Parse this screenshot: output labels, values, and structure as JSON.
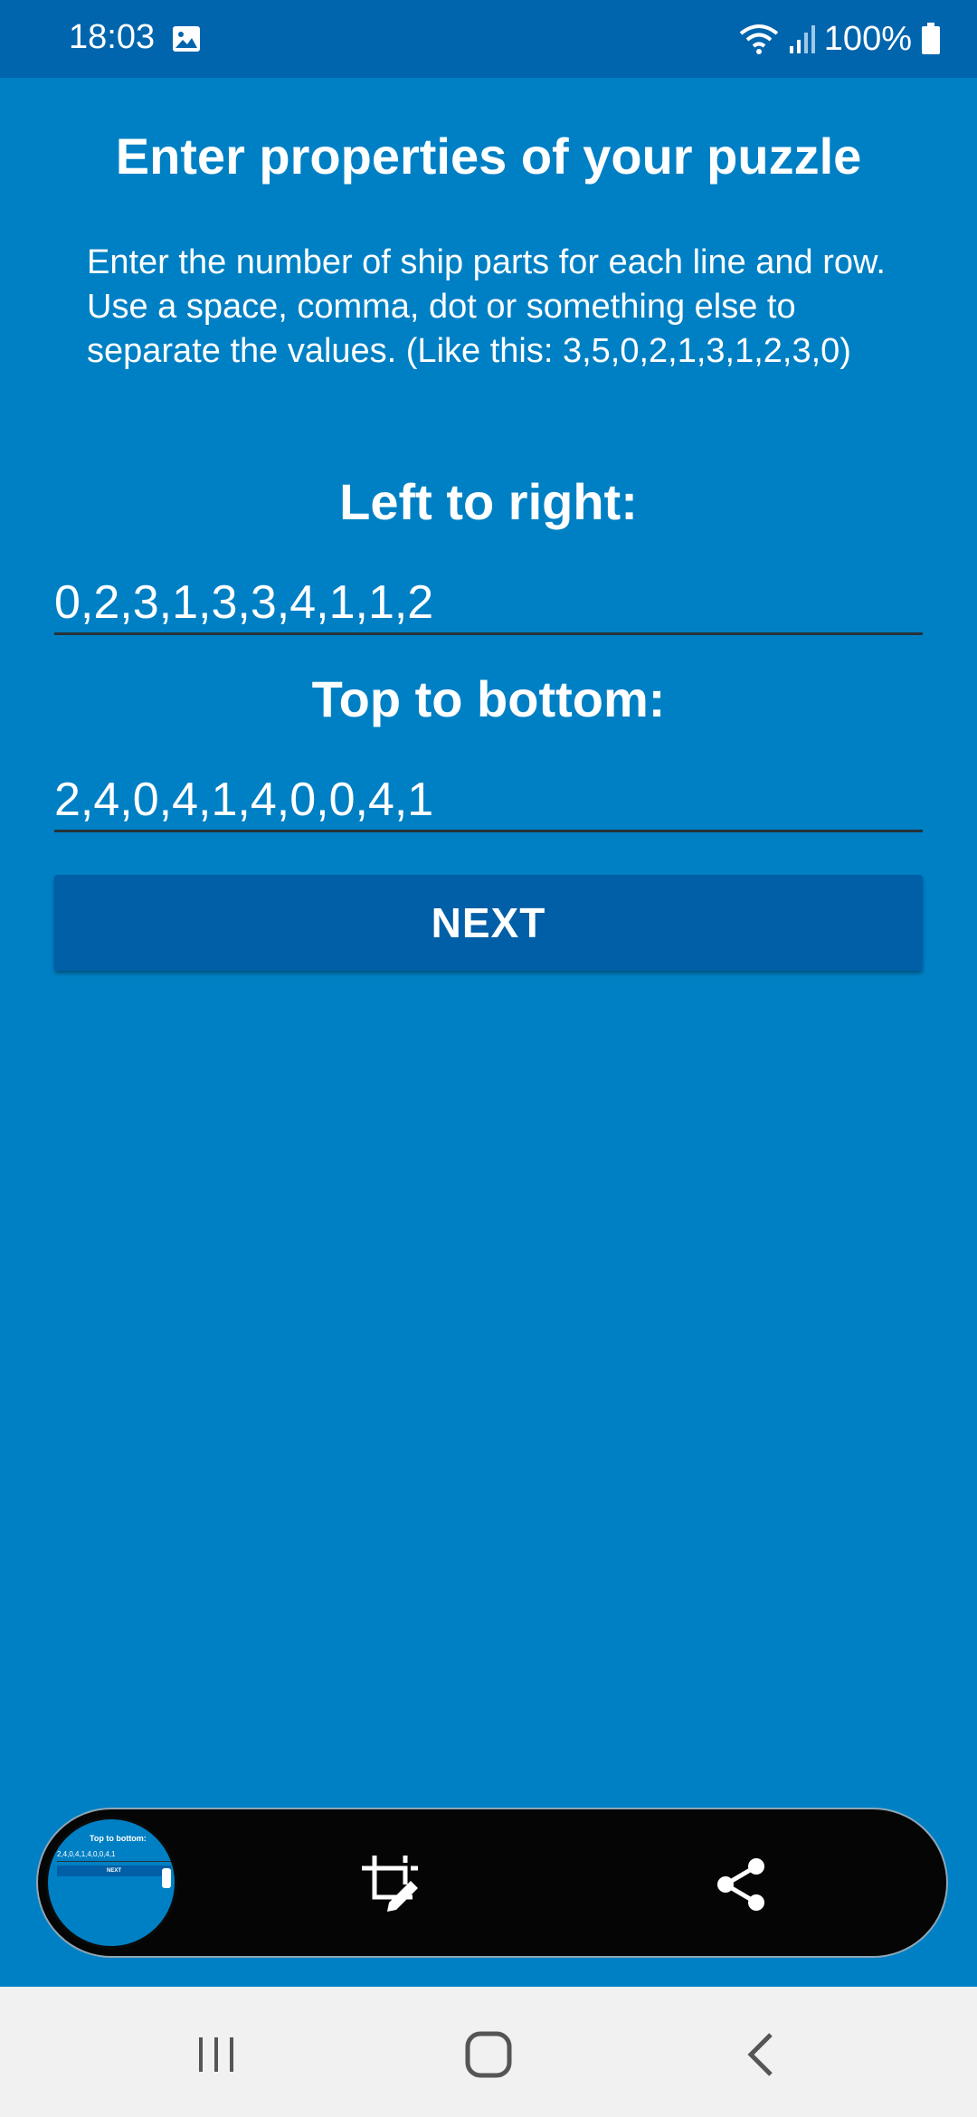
{
  "status_bar": {
    "time": "18:03",
    "battery_percent": "100%",
    "icons": [
      "gallery-icon",
      "wifi-icon",
      "signal-icon",
      "battery-icon"
    ]
  },
  "page": {
    "title": "Enter properties of your puzzle",
    "instructions": "Enter the number of ship parts for each line and row. Use a space, comma, dot or something else to separate the values. (Like this: 3,5,0,2,1,3,1,2,3,0)",
    "left_to_right_label": "Left to right:",
    "left_to_right_value": "0,2,3,1,3,3,4,1,1,2",
    "top_to_bottom_label": "Top to bottom:",
    "top_to_bottom_value": "2,4,0,4,1,4,0,0,4,1",
    "next_label": "NEXT"
  },
  "screenshot_toolbar": {
    "thumbnail_label": "Top to bottom:",
    "thumbnail_values": "2,4,0,4,1,4,0,0,4,1",
    "thumbnail_button": "NEXT",
    "icons": [
      "crop-edit-icon",
      "share-icon"
    ]
  },
  "nav_bar": {
    "icons": [
      "recent-apps-icon",
      "home-icon",
      "back-icon"
    ]
  },
  "colors": {
    "background": "#0080c4",
    "status_bar": "#0065ad",
    "button": "#005fa6",
    "nav_bar": "#f1f1f1",
    "toolbar": "#050505"
  }
}
